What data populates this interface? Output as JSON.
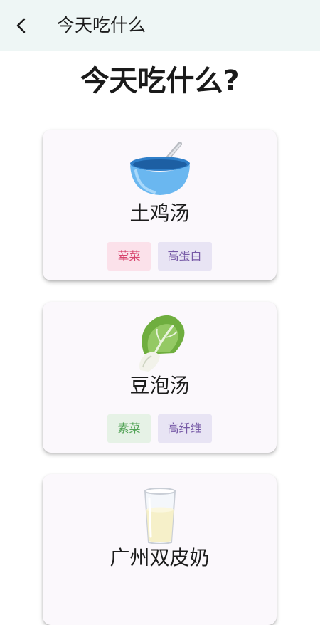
{
  "appbar": {
    "title": "今天吃什么",
    "back_icon": "chevron-left-icon"
  },
  "page": {
    "heading": "今天吃什么?"
  },
  "foods": [
    {
      "name": "土鸡汤",
      "icon": "soup-bowl-icon",
      "tags": [
        {
          "label": "荤菜",
          "color": "#d8456f"
        },
        {
          "label": "高蛋白",
          "color": "#7659a6"
        }
      ]
    },
    {
      "name": "豆泡汤",
      "icon": "bok-choy-icon",
      "tags": [
        {
          "label": "素菜",
          "color": "#53a457"
        },
        {
          "label": "高纤维",
          "color": "#7659a6"
        }
      ]
    },
    {
      "name": "广州双皮奶",
      "icon": "glass-of-milk-icon",
      "tags": []
    }
  ],
  "colors": {
    "appbar_bg": "#eef6f5",
    "card_bg": "#fbf8fc"
  }
}
